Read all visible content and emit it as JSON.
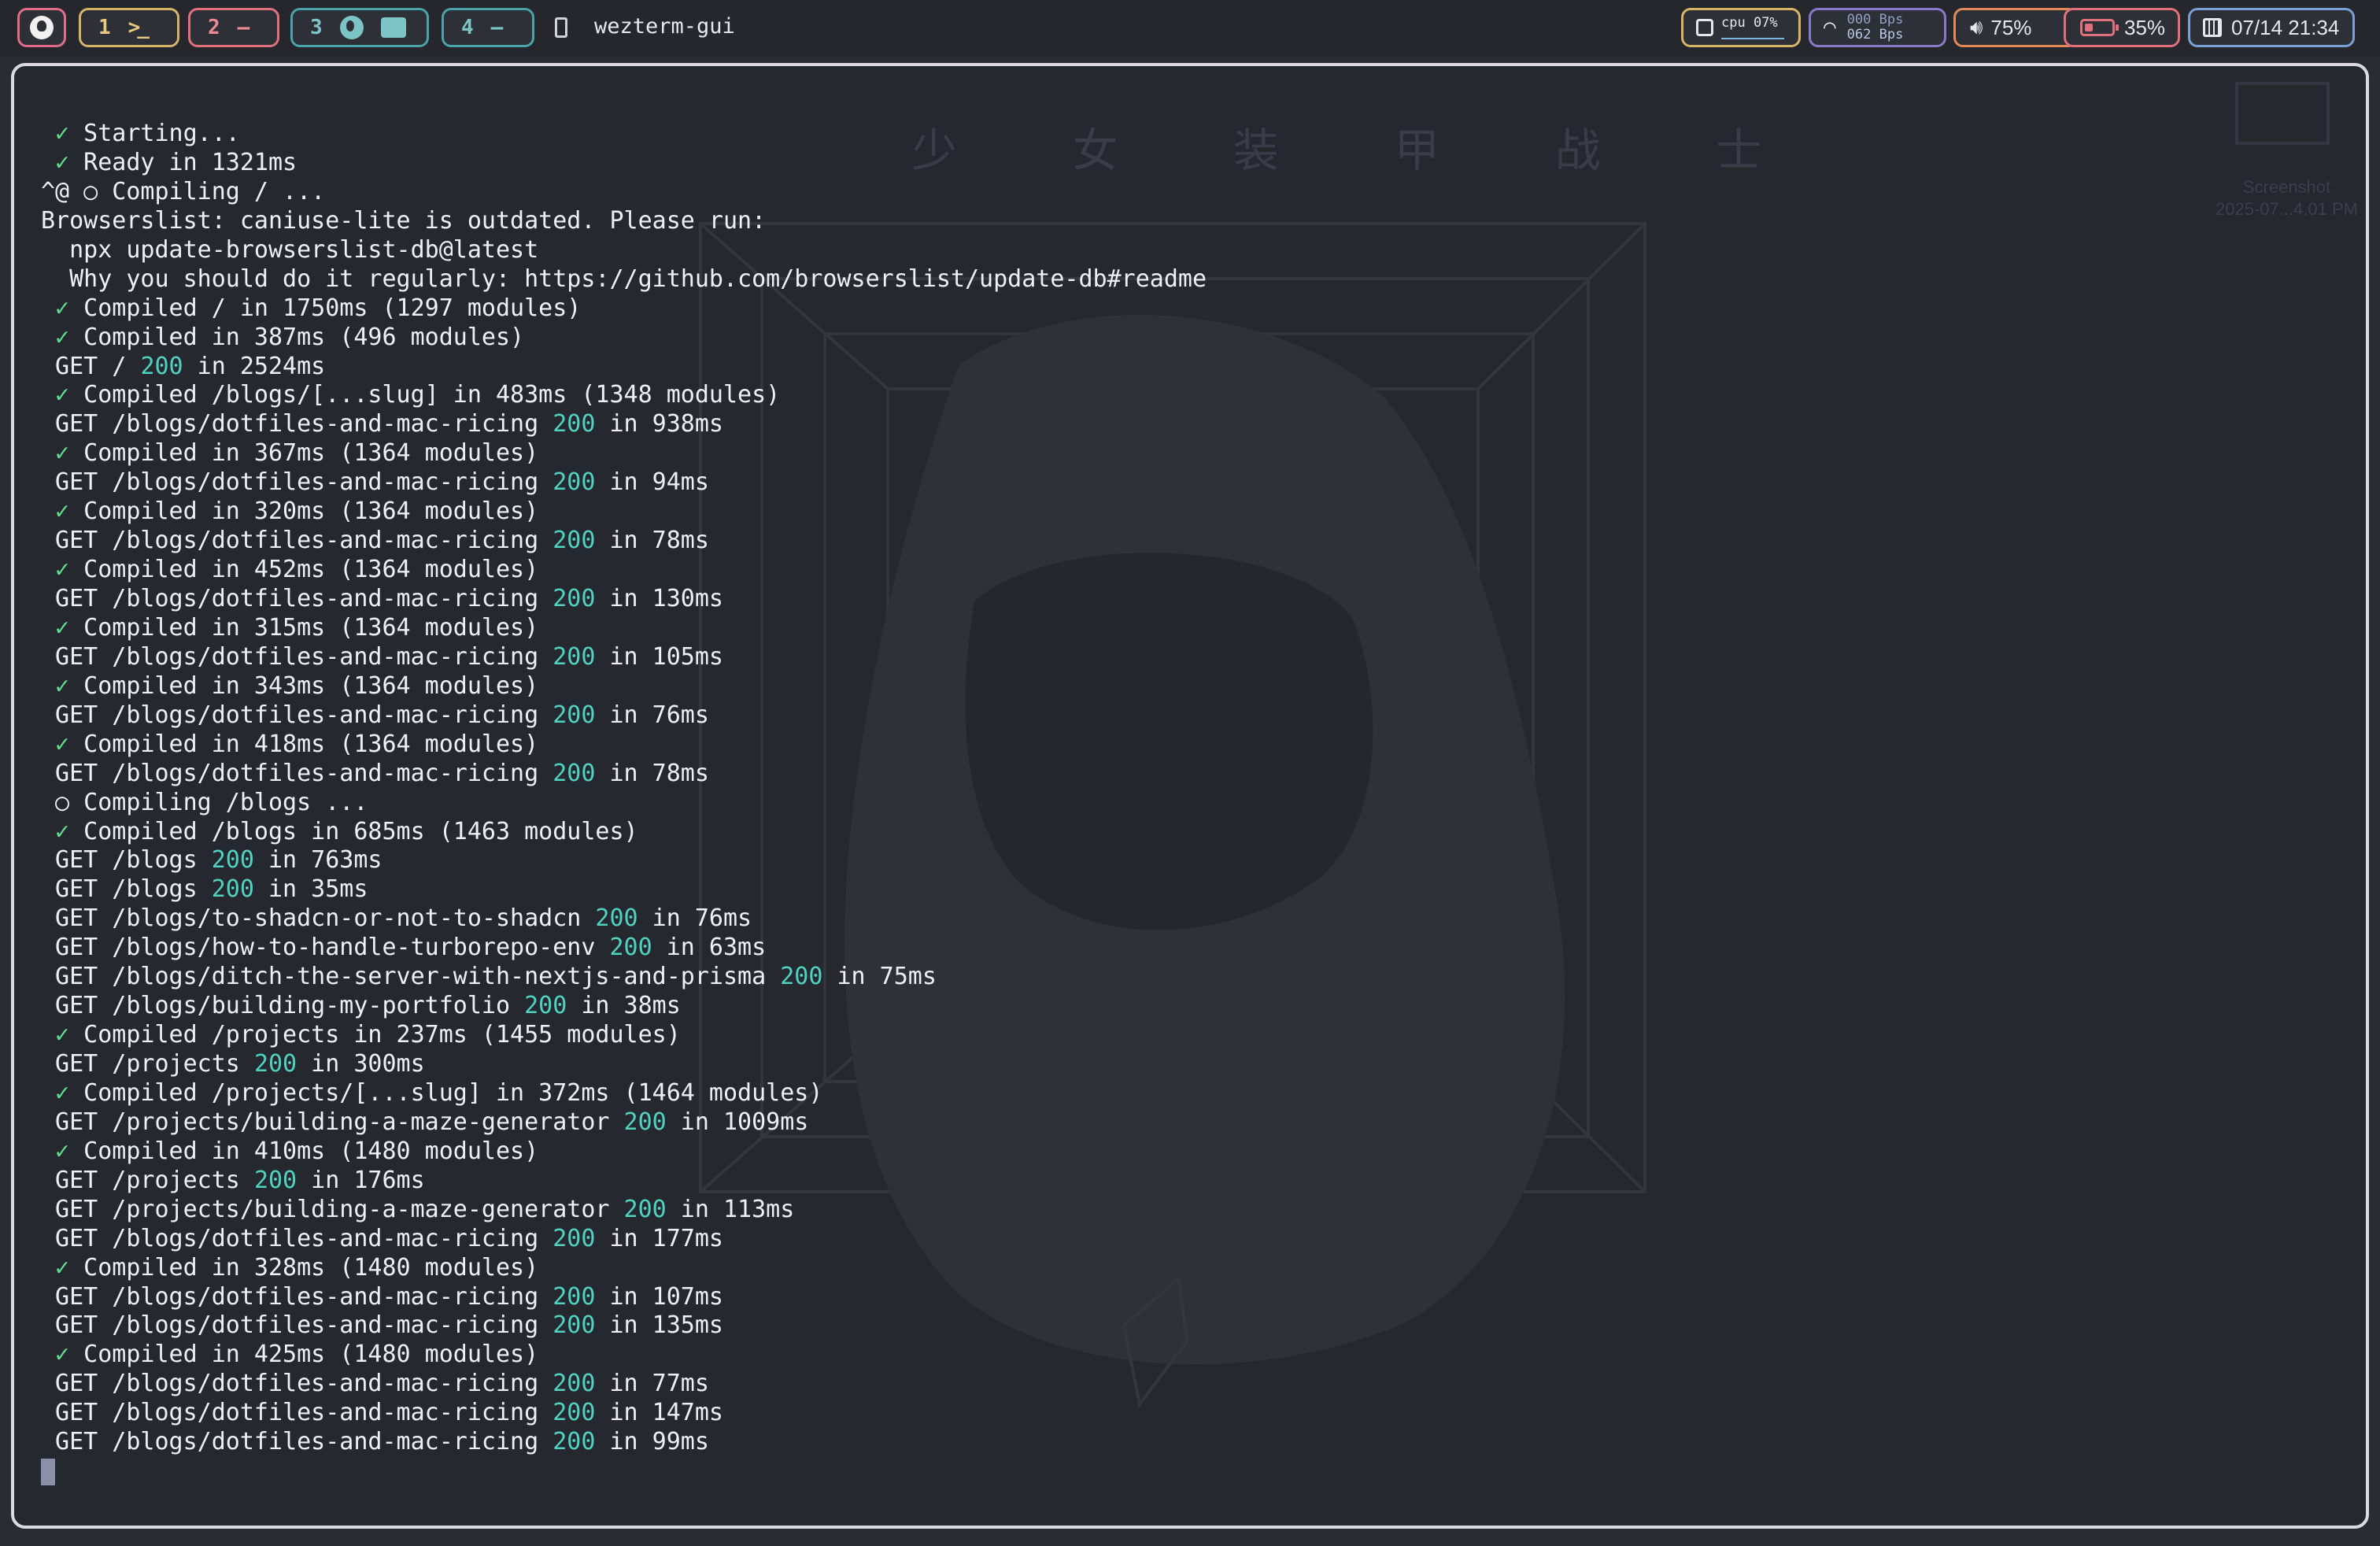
{
  "topbar": {
    "workspaces": [
      {
        "num": "1",
        "icon": ">_"
      },
      {
        "num": "2",
        "icon": "—"
      },
      {
        "num": "3"
      },
      {
        "num": "4",
        "icon": "—"
      }
    ],
    "app_name": "wezterm-gui",
    "cpu": {
      "label": "cpu 07%"
    },
    "network": {
      "up": "000 Bps",
      "down": "062 Bps"
    },
    "volume": "75%",
    "battery": "35%",
    "datetime": "07/14 21:34"
  },
  "desktop": {
    "wallpaper_title": "少 女 装 甲 战 士",
    "screenshot_label": "Screenshot",
    "screenshot_date": "2025-07...4.01 PM"
  },
  "terminal": {
    "lines": [
      {
        "prefix": " ✓",
        "text": " Starting..."
      },
      {
        "prefix": " ✓",
        "text": " Ready in 1321ms"
      },
      {
        "text": "^@ ○ Compiling / ..."
      },
      {
        "text": "Browserslist: caniuse-lite is outdated. Please run:"
      },
      {
        "text": "  npx update-browserslist-db@latest"
      },
      {
        "text": "  Why you should do it regularly: https://github.com/browserslist/update-db#readme"
      },
      {
        "prefix": " ✓",
        "text": " Compiled / in 1750ms (1297 modules)"
      },
      {
        "prefix": " ✓",
        "text": " Compiled in 387ms (496 modules)"
      },
      {
        "text": " GET / ",
        "code": "200",
        "tail": " in 2524ms"
      },
      {
        "prefix": " ✓",
        "text": " Compiled /blogs/[...slug] in 483ms (1348 modules)"
      },
      {
        "text": " GET /blogs/dotfiles-and-mac-ricing ",
        "code": "200",
        "tail": " in 938ms"
      },
      {
        "prefix": " ✓",
        "text": " Compiled in 367ms (1364 modules)"
      },
      {
        "text": " GET /blogs/dotfiles-and-mac-ricing ",
        "code": "200",
        "tail": " in 94ms"
      },
      {
        "prefix": " ✓",
        "text": " Compiled in 320ms (1364 modules)"
      },
      {
        "text": " GET /blogs/dotfiles-and-mac-ricing ",
        "code": "200",
        "tail": " in 78ms"
      },
      {
        "prefix": " ✓",
        "text": " Compiled in 452ms (1364 modules)"
      },
      {
        "text": " GET /blogs/dotfiles-and-mac-ricing ",
        "code": "200",
        "tail": " in 130ms"
      },
      {
        "prefix": " ✓",
        "text": " Compiled in 315ms (1364 modules)"
      },
      {
        "text": " GET /blogs/dotfiles-and-mac-ricing ",
        "code": "200",
        "tail": " in 105ms"
      },
      {
        "prefix": " ✓",
        "text": " Compiled in 343ms (1364 modules)"
      },
      {
        "text": " GET /blogs/dotfiles-and-mac-ricing ",
        "code": "200",
        "tail": " in 76ms"
      },
      {
        "prefix": " ✓",
        "text": " Compiled in 418ms (1364 modules)"
      },
      {
        "text": " GET /blogs/dotfiles-and-mac-ricing ",
        "code": "200",
        "tail": " in 78ms"
      },
      {
        "text": " ○ Compiling /blogs ..."
      },
      {
        "prefix": " ✓",
        "text": " Compiled /blogs in 685ms (1463 modules)"
      },
      {
        "text": " GET /blogs ",
        "code": "200",
        "tail": " in 763ms"
      },
      {
        "text": " GET /blogs ",
        "code": "200",
        "tail": " in 35ms"
      },
      {
        "text": " GET /blogs/to-shadcn-or-not-to-shadcn ",
        "code": "200",
        "tail": " in 76ms"
      },
      {
        "text": " GET /blogs/how-to-handle-turborepo-env ",
        "code": "200",
        "tail": " in 63ms"
      },
      {
        "text": " GET /blogs/ditch-the-server-with-nextjs-and-prisma ",
        "code": "200",
        "tail": " in 75ms"
      },
      {
        "text": " GET /blogs/building-my-portfolio ",
        "code": "200",
        "tail": " in 38ms"
      },
      {
        "prefix": " ✓",
        "text": " Compiled /projects in 237ms (1455 modules)"
      },
      {
        "text": " GET /projects ",
        "code": "200",
        "tail": " in 300ms"
      },
      {
        "prefix": " ✓",
        "text": " Compiled /projects/[...slug] in 372ms (1464 modules)"
      },
      {
        "text": " GET /projects/building-a-maze-generator ",
        "code": "200",
        "tail": " in 1009ms"
      },
      {
        "prefix": " ✓",
        "text": " Compiled in 410ms (1480 modules)"
      },
      {
        "text": " GET /projects ",
        "code": "200",
        "tail": " in 176ms"
      },
      {
        "text": " GET /projects/building-a-maze-generator ",
        "code": "200",
        "tail": " in 113ms"
      },
      {
        "text": " GET /blogs/dotfiles-and-mac-ricing ",
        "code": "200",
        "tail": " in 177ms"
      },
      {
        "prefix": " ✓",
        "text": " Compiled in 328ms (1480 modules)"
      },
      {
        "text": " GET /blogs/dotfiles-and-mac-ricing ",
        "code": "200",
        "tail": " in 107ms"
      },
      {
        "text": " GET /blogs/dotfiles-and-mac-ricing ",
        "code": "200",
        "tail": " in 135ms"
      },
      {
        "prefix": " ✓",
        "text": " Compiled in 425ms (1480 modules)"
      },
      {
        "text": " GET /blogs/dotfiles-and-mac-ricing ",
        "code": "200",
        "tail": " in 77ms"
      },
      {
        "text": " GET /blogs/dotfiles-and-mac-ricing ",
        "code": "200",
        "tail": " in 147ms"
      },
      {
        "text": " GET /blogs/dotfiles-and-mac-ricing ",
        "code": "200",
        "tail": " in 99ms"
      }
    ]
  },
  "colors": {
    "success": "#5fe08e",
    "status_code": "#4fd3c0",
    "text": "#eef0f4",
    "background": "#262830"
  }
}
